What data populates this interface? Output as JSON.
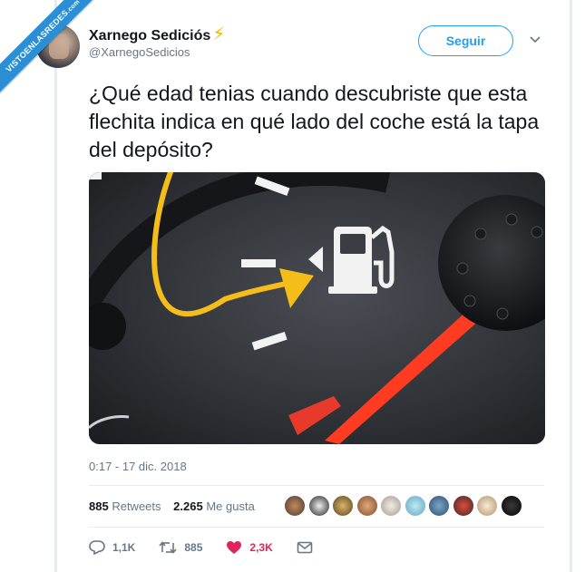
{
  "watermark": {
    "text": "VISTOENLASREDES",
    "suffix": ".com"
  },
  "author": {
    "display_name": "Xarnego Sediciós",
    "name_emoji": "⚡",
    "handle": "@XarnegoSedicios"
  },
  "header": {
    "follow_label": "Seguir",
    "menu_icon": "chevron-down-icon"
  },
  "tweet": {
    "text": "¿Qué edad tenias cuando descubriste que esta flechita indica en qué lado del coche está la tapa del depósito?",
    "timestamp": "0:17 - 17 dic. 2018"
  },
  "media": {
    "icons": [
      "fuel-pump-icon",
      "arrow-pointer-icon",
      "fuel-gauge-needle"
    ]
  },
  "stats": {
    "retweets_count": "885",
    "retweets_label": "Retweets",
    "likes_count": "2.265",
    "likes_label": "Me gusta"
  },
  "likers_count_shown": 10,
  "actions": {
    "reply_count": "1,1K",
    "retweet_count": "885",
    "like_count": "2,3K"
  },
  "colors": {
    "accent": "#1da1f2",
    "like": "#e0245e",
    "muted": "#657786",
    "ribbon": "#2b8fd6",
    "bolt": "#f5b800"
  }
}
